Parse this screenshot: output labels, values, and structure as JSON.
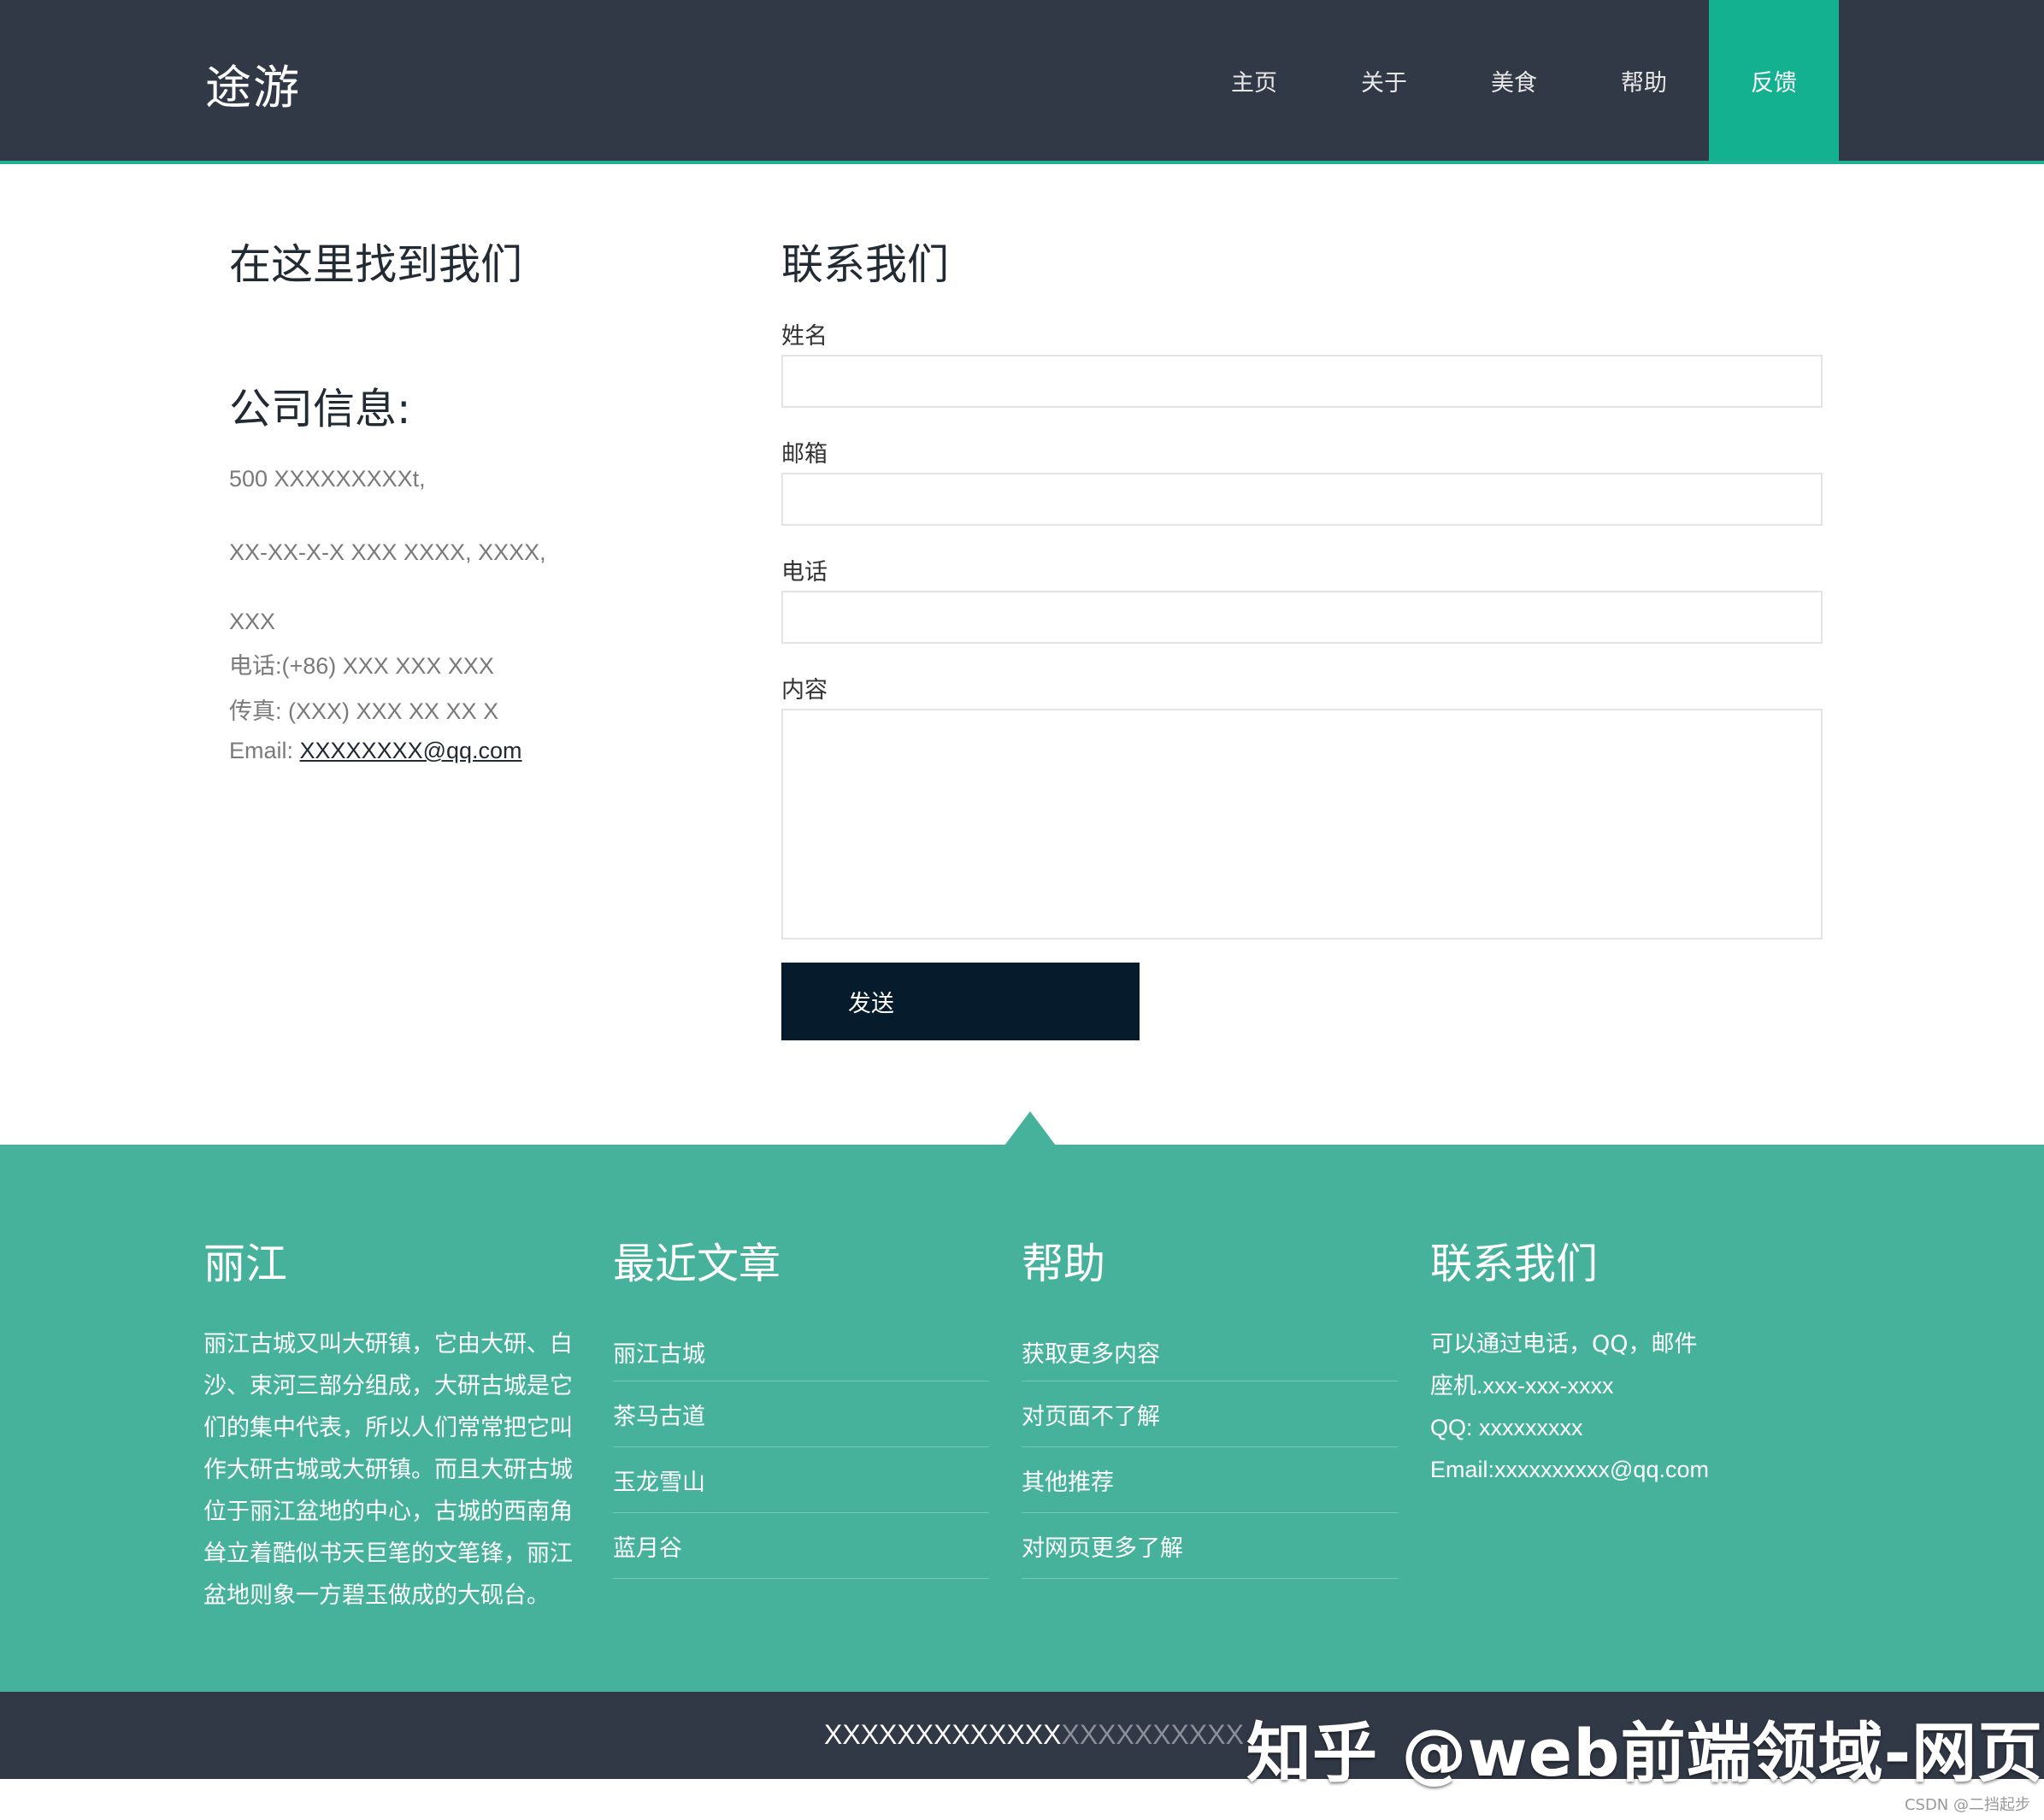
{
  "header": {
    "logo": "途游",
    "nav": [
      {
        "label": "主页"
      },
      {
        "label": "关于"
      },
      {
        "label": "美食"
      },
      {
        "label": "帮助"
      },
      {
        "label": "反馈"
      }
    ],
    "active_nav": "反馈"
  },
  "contact_info": {
    "find_title": "在这里找到我们",
    "company_title": "公司信息:",
    "address_1": "500 XXXXXXXXXt,",
    "address_2": "XX-XX-X-X XXX XXXX, XXXX,",
    "address_3": "XXX",
    "phone": "电话:(+86) XXX XXX XXX",
    "fax": "传真: (XXX) XXX XX XX X",
    "email_label": "Email: ",
    "email_value": "XXXXXXXX@qq.com"
  },
  "form": {
    "title": "联系我们",
    "name_label": "姓名",
    "email_label": "邮箱",
    "phone_label": "电话",
    "content_label": "内容",
    "name_value": "",
    "email_value": "",
    "phone_value": "",
    "content_value": "",
    "submit_label": "发送"
  },
  "footer": {
    "col1": {
      "title": "丽江",
      "description": "丽江古城又叫大研镇，它由大研、白沙、束河三部分组成，大研古城是它们的集中代表，所以人们常常把它叫作大研古城或大研镇。而且大研古城位于丽江盆地的中心，古城的西南角耸立着酷似书天巨笔的文笔锋，丽江盆地则象一方碧玉做成的大砚台。"
    },
    "col2": {
      "title": "最近文章",
      "items": [
        "丽江古城",
        "茶马古道",
        "玉龙雪山",
        "蓝月谷"
      ]
    },
    "col3": {
      "title": "帮助",
      "items": [
        "获取更多内容",
        "对页面不了解",
        "其他推荐",
        "对网页更多了解"
      ]
    },
    "col4": {
      "title": "联系我们",
      "lines": [
        "可以通过电话，QQ，邮件",
        "座机.xxx-xxx-xxxx",
        "QQ: xxxxxxxxx",
        "Email:xxxxxxxxxx@qq.com"
      ]
    }
  },
  "bottom": {
    "copyright_a": "XXXXXXXXXXXXX",
    "copyright_b": "XXXXXXXXXX",
    "watermark": "知乎 @web前端领域-网页...",
    "corner_mark": "CSDN @二挡起步"
  },
  "colors": {
    "header_bg": "#323946",
    "accent": "#14b191",
    "footer_bg": "#46b29b",
    "button_bg": "#061c2d"
  }
}
